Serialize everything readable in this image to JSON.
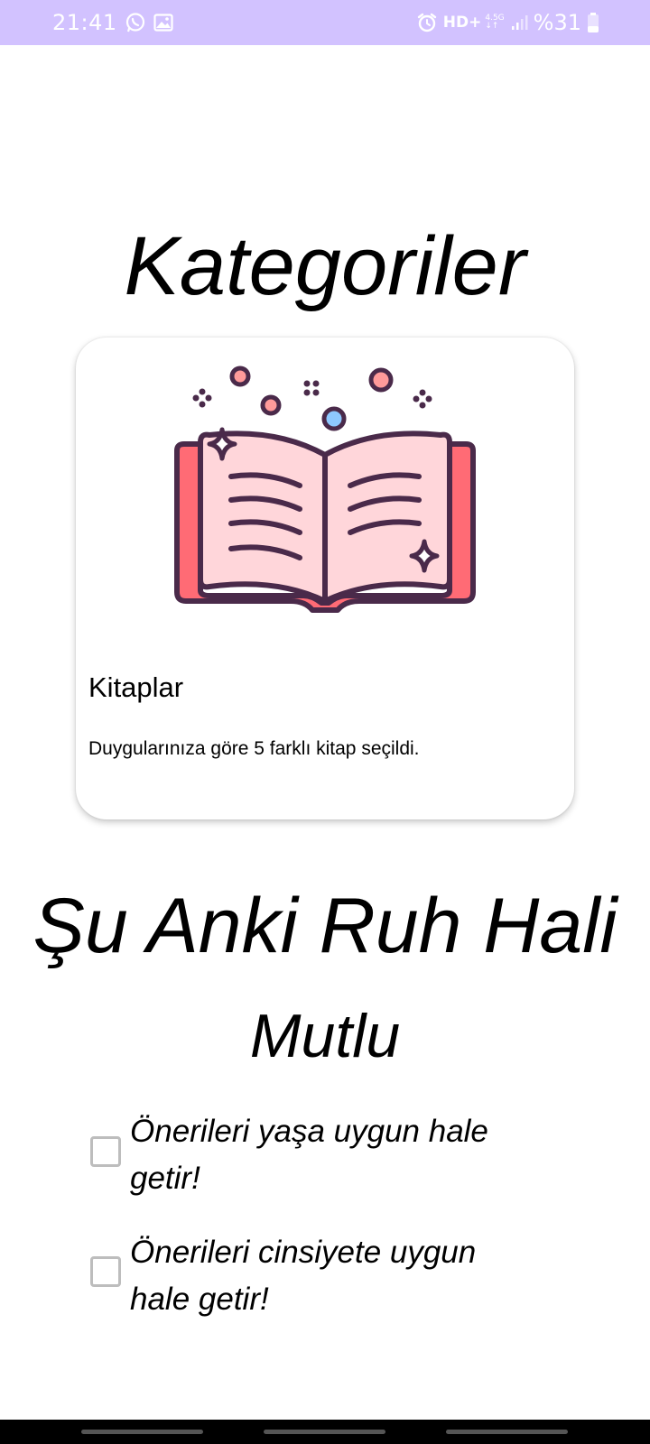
{
  "status_bar": {
    "time": "21:41",
    "icons_left": [
      "whatsapp-icon",
      "gallery-icon"
    ],
    "icons_right": [
      "alarm-icon",
      "signal-icon",
      "battery-icon"
    ],
    "hd_label": "HD+",
    "network_top": "4.5G",
    "network_bottom": "↓↑",
    "battery": "%31",
    "background": "#d2c2ff"
  },
  "page": {
    "title": "Kategoriler"
  },
  "category_card": {
    "image_icon": "open-book-icon",
    "title": "Kitaplar",
    "description": "Duygularınıza göre 5 farklı kitap seçildi."
  },
  "mood": {
    "heading": "Şu Anki Ruh Hali",
    "value": "Mutlu"
  },
  "options": [
    {
      "label": "Önerileri yaşa uygun hale getir!",
      "checked": false
    },
    {
      "label": "Önerileri cinsiyete uygun hale getir!",
      "checked": false
    }
  ],
  "colors": {
    "book_cover": "#ff6b75",
    "book_pages": "#ffd6da",
    "book_outline": "#4a2a4a",
    "accent_blue": "#8ec8ff"
  }
}
